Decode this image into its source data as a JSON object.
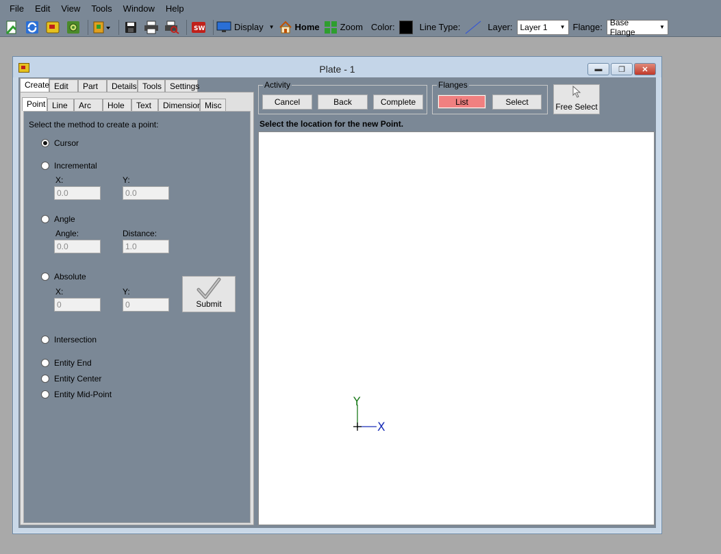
{
  "menu": [
    "File",
    "Edit",
    "View",
    "Tools",
    "Window",
    "Help"
  ],
  "toolbar": {
    "display_label": "Display",
    "home_label": "Home",
    "zoom_label": "Zoom",
    "color_label": "Color:",
    "color_value": "#000000",
    "line_type_label": "Line Type:",
    "layer_label": "Layer:",
    "layer_value": "Layer 1",
    "flange_label": "Flange:",
    "flange_value": "Base Flange"
  },
  "window": {
    "title": "Plate - 1"
  },
  "main_tabs": [
    "Create",
    "Edit",
    "Part",
    "Details",
    "Tools",
    "Settings"
  ],
  "main_tabs_active": "Create",
  "sub_tabs": [
    "Point",
    "Line",
    "Arc",
    "Hole",
    "Text",
    "Dimension",
    "Misc"
  ],
  "sub_tabs_active": "Point",
  "point_panel": {
    "instruction": "Select the method to create a point:",
    "options": {
      "cursor": "Cursor",
      "incremental": "Incremental",
      "angle": "Angle",
      "absolute": "Absolute",
      "intersection": "Intersection",
      "entity_end": "Entity End",
      "entity_center": "Entity Center",
      "entity_mid": "Entity Mid-Point"
    },
    "selected": "Cursor",
    "incremental": {
      "x_label": "X:",
      "x_value": "0.0",
      "y_label": "Y:",
      "y_value": "0.0"
    },
    "angle": {
      "angle_label": "Angle:",
      "angle_value": "0.0",
      "distance_label": "Distance:",
      "distance_value": "1.0"
    },
    "absolute": {
      "x_label": "X:",
      "x_value": "0",
      "y_label": "Y:",
      "y_value": "0"
    },
    "submit_label": "Submit"
  },
  "activity": {
    "title": "Activity",
    "cancel": "Cancel",
    "back": "Back",
    "complete": "Complete"
  },
  "flanges": {
    "title": "Flanges",
    "list": "List",
    "select": "Select"
  },
  "free_select_label": "Free Select",
  "prompt": "Select the location for the new Point.",
  "axis": {
    "x_label": "X",
    "y_label": "Y",
    "x_color": "#1a2fb8",
    "y_color": "#1a7a1a"
  },
  "accent_colors": {
    "list_button": "#f08080"
  }
}
